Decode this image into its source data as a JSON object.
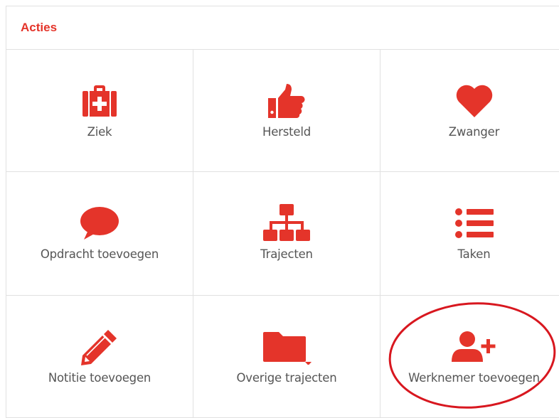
{
  "panel": {
    "title": "Acties"
  },
  "actions": [
    {
      "label": "Ziek",
      "icon": "first-aid-kit-icon"
    },
    {
      "label": "Hersteld",
      "icon": "thumbs-up-icon"
    },
    {
      "label": "Zwanger",
      "icon": "heart-icon"
    },
    {
      "label": "Opdracht toevoegen",
      "icon": "comment-icon"
    },
    {
      "label": "Trajecten",
      "icon": "sitemap-icon"
    },
    {
      "label": "Taken",
      "icon": "list-icon"
    },
    {
      "label": "Notitie toevoegen",
      "icon": "pencil-icon"
    },
    {
      "label": "Overige trajecten",
      "icon": "folder-dropdown-icon"
    },
    {
      "label": "Werknemer toevoegen",
      "icon": "user-plus-icon"
    }
  ],
  "colors": {
    "accent": "#e4342a",
    "text": "#555555",
    "border": "#e1e1e1",
    "annotation": "#d8171f"
  }
}
